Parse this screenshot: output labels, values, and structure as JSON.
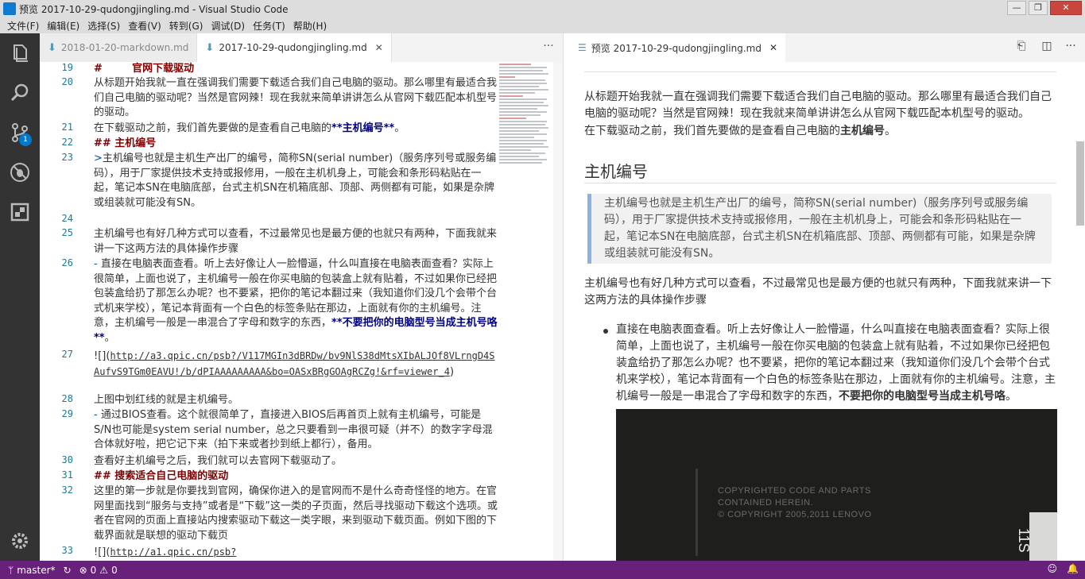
{
  "window": {
    "title": "预览 2017-10-29-qudongjingling.md - Visual Studio Code",
    "controls": [
      "—",
      "❐",
      "✕"
    ]
  },
  "menu": [
    "文件(F)",
    "编辑(E)",
    "选择(S)",
    "查看(V)",
    "转到(G)",
    "调试(D)",
    "任务(T)",
    "帮助(H)"
  ],
  "activity": {
    "scm_badge": "1"
  },
  "editor_tabs": [
    {
      "label": "2018-01-20-markdown.md",
      "active": false
    },
    {
      "label": "2017-10-29-qudongjingling.md",
      "active": true
    }
  ],
  "editor_lines": {
    "l19": {
      "num": "19",
      "a": "#",
      "b": "官网下载驱动"
    },
    "l20": {
      "num": "20",
      "text": "从标题开始我就一直在强调我们需要下载适合我们自己电脑的驱动。那么哪里有最适合我们自己电脑的驱动呢？当然是官网辣！现在我就来简单讲讲怎么从官网下载匹配本机型号的驱动。"
    },
    "l21": {
      "num": "21",
      "a": "在下载驱动之前，我们首先要做的是查看自己电脑的",
      "b": "**主机编号**",
      "c": "。"
    },
    "l22": {
      "num": "22",
      "text": "##  主机编号"
    },
    "l23": {
      "num": "23",
      "a": ">",
      "text": "主机编号也就是主机生产出厂的编号，简称SN(serial number)（服务序列号或服务编码），用于厂家提供技术支持或报修用，一般在主机机身上，可能会和条形码粘贴在一起，笔记本SN在电脑底部，台式主机SN在机箱底部、顶部、两侧都有可能，如果是杂牌或组装就可能没有SN。"
    },
    "l24": {
      "num": "24"
    },
    "l25": {
      "num": "25",
      "text": "主机编号也有好几种方式可以查看，不过最常见也是最方便的也就只有两种，下面我就来讲一下这两方法的具体操作步骤"
    },
    "l26": {
      "num": "26",
      "a": "- ",
      "text": "直接在电脑表面查看。听上去好像让人一脸懵逼，什么叫直接在电脑表面查看？实际上很简单，上面也说了，主机编号一般在你买电脑的包装盒上就有贴着，不过如果你已经把包装盒给扔了那怎么办呢？也不要紧，把你的笔记本翻过来（我知道你们没几个会带个台式机来学校），笔记本背面有一个白色的标签条贴在那边，上面就有你的主机编号。注意，主机编号一般是一串混合了字母和数字的东西，",
      "b": "**不要把你的电脑型号当成主机号咯**",
      "c": "。"
    },
    "l27": {
      "num": "27",
      "a": "![](",
      "url": "http://a3.qpic.cn/psb?/V117MGIn3dBRDw/bv9Nl​S38dMtsXIbALJOf8VLrngD4SAufvS9TGm0EAVU!/b/dPIAAAAAAAAA&bo=OASxBRgGOAgRCZg!&rf=viewer_4",
      "c": ")"
    },
    "l28": {
      "num": "28",
      "text": "上图中划红线的就是主机编号。"
    },
    "l29": {
      "num": "29",
      "a": "- ",
      "text": "通过BIOS查看。这个就很简单了，直接进入BIOS后再首页上就有主机编号，可能是S/N也可能是system serial number，总之只要看到一串很可疑（并不）的数字字母混合体就好啦，把它记下来（拍下来或者抄到纸上都行），备用。"
    },
    "l30": {
      "num": "30",
      "text": "查看好主机编号之后，我们就可以去官网下载驱动了。"
    },
    "l31": {
      "num": "31",
      "text": "##  搜索适合自己电脑的驱动"
    },
    "l32": {
      "num": "32",
      "text": "这里的第一步就是你要找到官网，确保你进入的是官网而不是什么奇奇怪怪的地方。在官网里面找到“服务与支持”或者是“下载”这一类的子页面，然后寻找驱动下载这个选项。或者在官网的页面上直接站内搜索驱动下载这一类字眼，来到驱动下载页面。例如下图的下载界面就是联想的驱动下载页"
    },
    "l33": {
      "num": "33",
      "a": "![](",
      "url": "http://a1.qpic.cn/psb?"
    }
  },
  "preview_tab": {
    "label": "预览 2017-10-29-qudongjingling.md"
  },
  "preview": {
    "p1": "从标题开始我就一直在强调我们需要下载适合我们自己电脑的驱动。那么哪里有最适合我们自己电脑的驱动呢？当然是官网辣！现在我就来简单讲讲怎么从官网下载匹配本机型号的驱动。",
    "p2a": "在下载驱动之前，我们首先要做的是查看自己电脑的",
    "p2b": "主机编号",
    "p2c": "。",
    "h2": "主机编号",
    "quote": "主机编号也就是主机生产出厂的编号，简称SN(serial number)（服务序列号或服务编码），用于厂家提供技术支持或报修用，一般在主机机身上，可能会和条形码粘贴在一起，笔记本SN在电脑底部，台式主机SN在机箱底部、顶部、两侧都有可能，如果是杂牌或组装就可能没有SN。",
    "p3": "主机编号也有好几种方式可以查看，不过最常见也是最方便的也就只有两种，下面我就来讲一下这两方法的具体操作步骤",
    "li1a": "直接在电脑表面查看。听上去好像让人一脸懵逼，什么叫直接在电脑表面查看？实际上很简单，上面也说了，主机编号一般在你买电脑的包装盒上就有贴着，不过如果你已经把包装盒给扔了那怎么办呢？也不要紧，把你的笔记本翻过来（我知道你们没几个会带个台式机来学校），笔记本背面有一个白色的标签条贴在那边，上面就有你的主机编号。注意，主机编号一般是一串混合了字母和数字的东西，",
    "li1b": "不要把你的电脑型号当成主机号咯",
    "li1c": "。",
    "photo_text": [
      "COPYRIGHTED CODE AND PARTS",
      "CONTAINED HEREIN.",
      "© COPYRIGHT 2005,2011 LENOVO"
    ],
    "photo_side": "11S"
  },
  "status": {
    "branch": "master*",
    "errors": "0",
    "warnings": "0"
  }
}
